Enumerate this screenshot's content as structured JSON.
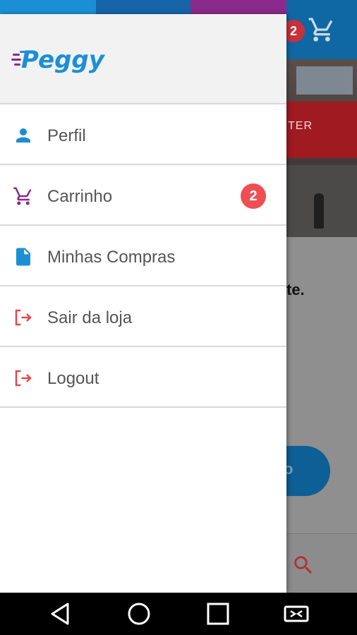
{
  "brand": {
    "logo_text": "Peggy",
    "colors": {
      "primary": "#1b8fd6",
      "purple": "#8a2a8a",
      "red": "#ef4f52",
      "text": "#555555"
    }
  },
  "drawer": {
    "items": [
      {
        "label": "Perfil",
        "icon": "person-icon"
      },
      {
        "label": "Carrinho",
        "icon": "cart-icon",
        "badge": "2"
      },
      {
        "label": "Minhas Compras",
        "icon": "document-icon"
      },
      {
        "label": "Sair da loja",
        "icon": "exit-icon"
      },
      {
        "label": "Logout",
        "icon": "exit-icon"
      }
    ]
  },
  "background": {
    "cart_badge": "2",
    "awning_text": "TER",
    "body_text": "te.",
    "pill_text": "o"
  },
  "navbar": {
    "buttons": [
      "back-icon",
      "home-icon",
      "recents-icon",
      "screen-cast-icon"
    ]
  }
}
